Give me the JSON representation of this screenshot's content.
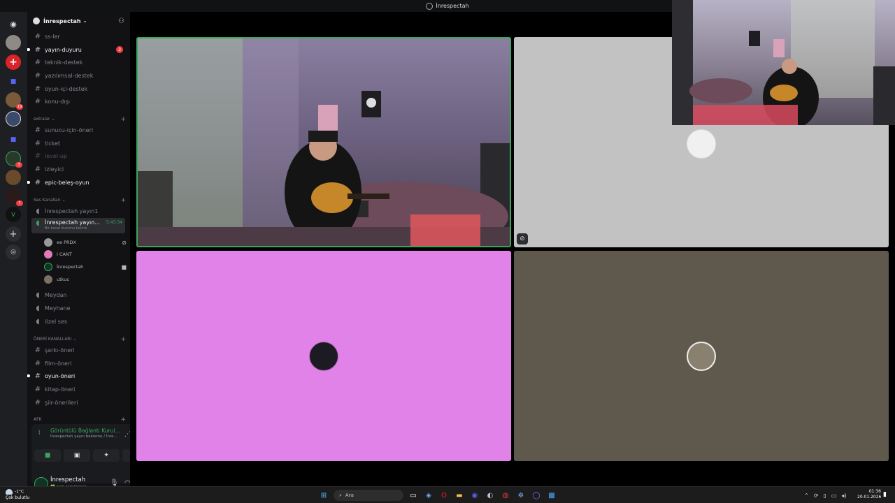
{
  "window": {
    "title": "İnrespectah"
  },
  "rail": {
    "colors": {
      "rail_bg": "#1e1f22",
      "brand": "#5865f2"
    },
    "servers": [
      {
        "icon": "discord-icon",
        "badge": ""
      },
      {
        "icon": "server-avatar",
        "badge": ""
      },
      {
        "icon": "server-red-cross",
        "badge": ""
      },
      {
        "icon": "folder-icon",
        "badge": ""
      },
      {
        "icon": "server-avatar",
        "badge": "19"
      },
      {
        "icon": "server-avatar",
        "badge": ""
      },
      {
        "icon": "folder-icon",
        "badge": ""
      },
      {
        "icon": "server-avatar",
        "badge": "3"
      },
      {
        "icon": "server-avatar",
        "badge": ""
      },
      {
        "icon": "server-avatar",
        "badge": "7"
      },
      {
        "icon": "server-avatar",
        "badge": ""
      }
    ]
  },
  "server": {
    "name": "İnrespectah"
  },
  "channels": {
    "text_top": [
      {
        "name": "ss-ler",
        "state": "read"
      },
      {
        "name": "yayın-duyuru",
        "state": "unread",
        "mentions": "3"
      },
      {
        "name": "teknik-destek",
        "state": "read"
      },
      {
        "name": "yazılımsal-destek",
        "state": "read"
      },
      {
        "name": "oyun-içi-destek",
        "state": "read"
      },
      {
        "name": "konu-dışı",
        "state": "read"
      }
    ],
    "extras_category": "extralar",
    "extras": [
      {
        "name": "sunucu-için-öneri",
        "state": "read"
      },
      {
        "name": "ticket",
        "state": "read"
      },
      {
        "name": "level-up",
        "state": "muted"
      },
      {
        "name": "izleyici",
        "state": "read"
      },
      {
        "name": "epic-beleş-oyun",
        "state": "unread"
      }
    ],
    "voice_category": "Ses Kanalları",
    "voice": [
      {
        "name": "İnrespectah yayın1"
      },
      {
        "name": "İnrespectah yayın...",
        "timer": "5:43:34",
        "subtitle": "Bir kanal durumu belirle"
      }
    ],
    "voice_users": [
      {
        "name": "ee PRDX",
        "trail": "deafened"
      },
      {
        "name": "I CANT",
        "trail": ""
      },
      {
        "name": "İnrespectah",
        "trail": "video"
      },
      {
        "name": "utkuc",
        "trail": ""
      }
    ],
    "voice_more": [
      {
        "name": "Meydan"
      },
      {
        "name": "Meyhane"
      },
      {
        "name": "özel ses"
      }
    ],
    "suggest_category": "ÖNERİ KANALLARI",
    "suggest": [
      {
        "name": "şarkı-öneri",
        "state": "read"
      },
      {
        "name": "film-öneri",
        "state": "read"
      },
      {
        "name": "oyun-öneri",
        "state": "unread"
      },
      {
        "name": "kitap-öneri",
        "state": "read"
      },
      {
        "name": "şiir-önerileri",
        "state": "read"
      }
    ],
    "afk_category": "AFK"
  },
  "voice_panel": {
    "status": "Görüntülü Bağlantı Kurul...",
    "subtitle": "İnrespectah yayın bekleme / İnre...",
    "status_color": "#3ba55c"
  },
  "user": {
    "name": "İnrespectah",
    "status": "💚 kick.com/inresp..."
  },
  "tiles": {
    "colors": {
      "cam_border": "#3ba55c",
      "pink": "#e082e8",
      "grey": "#c2c2c2",
      "brown": "#5f584c"
    }
  },
  "taskbar": {
    "weather_temp": "-1°C",
    "weather_desc": "Çok bulutlu",
    "search_placeholder": "Ara",
    "time": "01:36",
    "date": "20.01.2026"
  }
}
